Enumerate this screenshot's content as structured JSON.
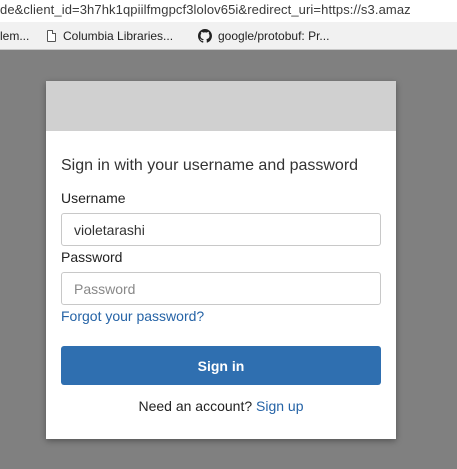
{
  "browser": {
    "url": "de&client_id=3h7hk1qpiilfmgpcf3lolov65i&redirect_uri=https://s3.amaz",
    "bookmarks": [
      {
        "label": "lem..."
      },
      {
        "label": "Columbia Libraries..."
      },
      {
        "label": "google/protobuf: Pr..."
      }
    ]
  },
  "dialog": {
    "title": "Sign in with your username and password",
    "username_label": "Username",
    "username_value": "violetarashi",
    "password_label": "Password",
    "password_placeholder": "Password",
    "forgot_link": "Forgot your password?",
    "signin_button": "Sign in",
    "need_account": "Need an account?",
    "signup_link": "Sign up"
  }
}
